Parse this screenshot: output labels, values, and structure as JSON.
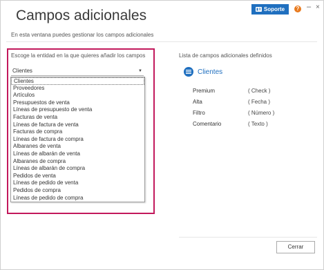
{
  "window": {
    "title": "Campos adicionales",
    "subtitle": "En esta ventana puedes gestionar los campos adicionales",
    "support_label": "Soporte",
    "help_glyph": "?",
    "minimize_glyph": "–",
    "close_glyph": "×"
  },
  "left": {
    "label": "Escoge la entidad en la que quieres añadir los campos",
    "selected_value": "Clientes",
    "options": [
      "Clientes",
      "Proveedores",
      "Artículos",
      "Presupuestos de venta",
      "Líneas de presupuesto de venta",
      "Facturas de venta",
      "Líneas de factura de venta",
      "Facturas de compra",
      "Líneas de factura de compra",
      "Albaranes de venta",
      "Líneas de albarán de venta",
      "Albaranes de compra",
      "Líneas de albarán de compra",
      "Pedidos de venta",
      "Líneas de pedido de venta",
      "Pedidos de compra",
      "Líneas de pedido de compra"
    ]
  },
  "right": {
    "label": "Lista de campos adicionales definidos",
    "entity_name": "Clientes",
    "fields": [
      {
        "name": "Premium",
        "type": "( Check )"
      },
      {
        "name": "Alta",
        "type": "( Fecha )"
      },
      {
        "name": "Filtro",
        "type": "( Número )"
      },
      {
        "name": "Comentario",
        "type": "( Texto )"
      }
    ]
  },
  "footer": {
    "close_label": "Cerrar"
  },
  "colors": {
    "accent": "#1f6fbf",
    "highlight_border": "#c2185b",
    "help": "#e87a1e"
  }
}
